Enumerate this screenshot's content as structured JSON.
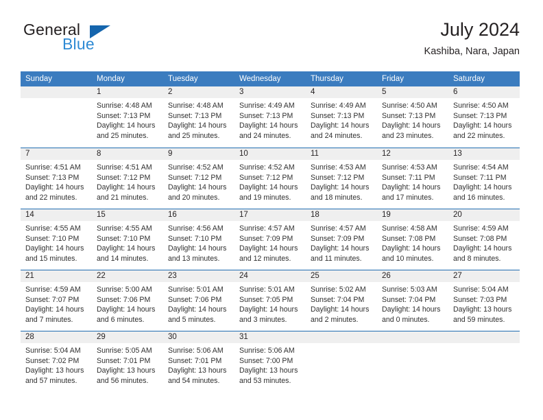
{
  "brand": {
    "name_part1": "General",
    "name_part2": "Blue",
    "triangle_color": "#1565ad",
    "blue_color": "#2e8ad4"
  },
  "header": {
    "title": "July 2024",
    "subtitle": "Kashiba, Nara, Japan",
    "header_bg": "#3b7cbf",
    "row_divider": "#1f6cb0",
    "day_band_bg": "#efefef"
  },
  "weekdays": [
    "Sunday",
    "Monday",
    "Tuesday",
    "Wednesday",
    "Thursday",
    "Friday",
    "Saturday"
  ],
  "weeks": [
    [
      {
        "date": "",
        "empty": true,
        "sunrise": "",
        "sunset": "",
        "daylight1": "",
        "daylight2": ""
      },
      {
        "date": "1",
        "sunrise": "Sunrise: 4:48 AM",
        "sunset": "Sunset: 7:13 PM",
        "daylight1": "Daylight: 14 hours",
        "daylight2": "and 25 minutes."
      },
      {
        "date": "2",
        "sunrise": "Sunrise: 4:48 AM",
        "sunset": "Sunset: 7:13 PM",
        "daylight1": "Daylight: 14 hours",
        "daylight2": "and 25 minutes."
      },
      {
        "date": "3",
        "sunrise": "Sunrise: 4:49 AM",
        "sunset": "Sunset: 7:13 PM",
        "daylight1": "Daylight: 14 hours",
        "daylight2": "and 24 minutes."
      },
      {
        "date": "4",
        "sunrise": "Sunrise: 4:49 AM",
        "sunset": "Sunset: 7:13 PM",
        "daylight1": "Daylight: 14 hours",
        "daylight2": "and 24 minutes."
      },
      {
        "date": "5",
        "sunrise": "Sunrise: 4:50 AM",
        "sunset": "Sunset: 7:13 PM",
        "daylight1": "Daylight: 14 hours",
        "daylight2": "and 23 minutes."
      },
      {
        "date": "6",
        "sunrise": "Sunrise: 4:50 AM",
        "sunset": "Sunset: 7:13 PM",
        "daylight1": "Daylight: 14 hours",
        "daylight2": "and 22 minutes."
      }
    ],
    [
      {
        "date": "7",
        "sunrise": "Sunrise: 4:51 AM",
        "sunset": "Sunset: 7:13 PM",
        "daylight1": "Daylight: 14 hours",
        "daylight2": "and 22 minutes."
      },
      {
        "date": "8",
        "sunrise": "Sunrise: 4:51 AM",
        "sunset": "Sunset: 7:12 PM",
        "daylight1": "Daylight: 14 hours",
        "daylight2": "and 21 minutes."
      },
      {
        "date": "9",
        "sunrise": "Sunrise: 4:52 AM",
        "sunset": "Sunset: 7:12 PM",
        "daylight1": "Daylight: 14 hours",
        "daylight2": "and 20 minutes."
      },
      {
        "date": "10",
        "sunrise": "Sunrise: 4:52 AM",
        "sunset": "Sunset: 7:12 PM",
        "daylight1": "Daylight: 14 hours",
        "daylight2": "and 19 minutes."
      },
      {
        "date": "11",
        "sunrise": "Sunrise: 4:53 AM",
        "sunset": "Sunset: 7:12 PM",
        "daylight1": "Daylight: 14 hours",
        "daylight2": "and 18 minutes."
      },
      {
        "date": "12",
        "sunrise": "Sunrise: 4:53 AM",
        "sunset": "Sunset: 7:11 PM",
        "daylight1": "Daylight: 14 hours",
        "daylight2": "and 17 minutes."
      },
      {
        "date": "13",
        "sunrise": "Sunrise: 4:54 AM",
        "sunset": "Sunset: 7:11 PM",
        "daylight1": "Daylight: 14 hours",
        "daylight2": "and 16 minutes."
      }
    ],
    [
      {
        "date": "14",
        "sunrise": "Sunrise: 4:55 AM",
        "sunset": "Sunset: 7:10 PM",
        "daylight1": "Daylight: 14 hours",
        "daylight2": "and 15 minutes."
      },
      {
        "date": "15",
        "sunrise": "Sunrise: 4:55 AM",
        "sunset": "Sunset: 7:10 PM",
        "daylight1": "Daylight: 14 hours",
        "daylight2": "and 14 minutes."
      },
      {
        "date": "16",
        "sunrise": "Sunrise: 4:56 AM",
        "sunset": "Sunset: 7:10 PM",
        "daylight1": "Daylight: 14 hours",
        "daylight2": "and 13 minutes."
      },
      {
        "date": "17",
        "sunrise": "Sunrise: 4:57 AM",
        "sunset": "Sunset: 7:09 PM",
        "daylight1": "Daylight: 14 hours",
        "daylight2": "and 12 minutes."
      },
      {
        "date": "18",
        "sunrise": "Sunrise: 4:57 AM",
        "sunset": "Sunset: 7:09 PM",
        "daylight1": "Daylight: 14 hours",
        "daylight2": "and 11 minutes."
      },
      {
        "date": "19",
        "sunrise": "Sunrise: 4:58 AM",
        "sunset": "Sunset: 7:08 PM",
        "daylight1": "Daylight: 14 hours",
        "daylight2": "and 10 minutes."
      },
      {
        "date": "20",
        "sunrise": "Sunrise: 4:59 AM",
        "sunset": "Sunset: 7:08 PM",
        "daylight1": "Daylight: 14 hours",
        "daylight2": "and 8 minutes."
      }
    ],
    [
      {
        "date": "21",
        "sunrise": "Sunrise: 4:59 AM",
        "sunset": "Sunset: 7:07 PM",
        "daylight1": "Daylight: 14 hours",
        "daylight2": "and 7 minutes."
      },
      {
        "date": "22",
        "sunrise": "Sunrise: 5:00 AM",
        "sunset": "Sunset: 7:06 PM",
        "daylight1": "Daylight: 14 hours",
        "daylight2": "and 6 minutes."
      },
      {
        "date": "23",
        "sunrise": "Sunrise: 5:01 AM",
        "sunset": "Sunset: 7:06 PM",
        "daylight1": "Daylight: 14 hours",
        "daylight2": "and 5 minutes."
      },
      {
        "date": "24",
        "sunrise": "Sunrise: 5:01 AM",
        "sunset": "Sunset: 7:05 PM",
        "daylight1": "Daylight: 14 hours",
        "daylight2": "and 3 minutes."
      },
      {
        "date": "25",
        "sunrise": "Sunrise: 5:02 AM",
        "sunset": "Sunset: 7:04 PM",
        "daylight1": "Daylight: 14 hours",
        "daylight2": "and 2 minutes."
      },
      {
        "date": "26",
        "sunrise": "Sunrise: 5:03 AM",
        "sunset": "Sunset: 7:04 PM",
        "daylight1": "Daylight: 14 hours",
        "daylight2": "and 0 minutes."
      },
      {
        "date": "27",
        "sunrise": "Sunrise: 5:04 AM",
        "sunset": "Sunset: 7:03 PM",
        "daylight1": "Daylight: 13 hours",
        "daylight2": "and 59 minutes."
      }
    ],
    [
      {
        "date": "28",
        "sunrise": "Sunrise: 5:04 AM",
        "sunset": "Sunset: 7:02 PM",
        "daylight1": "Daylight: 13 hours",
        "daylight2": "and 57 minutes."
      },
      {
        "date": "29",
        "sunrise": "Sunrise: 5:05 AM",
        "sunset": "Sunset: 7:01 PM",
        "daylight1": "Daylight: 13 hours",
        "daylight2": "and 56 minutes."
      },
      {
        "date": "30",
        "sunrise": "Sunrise: 5:06 AM",
        "sunset": "Sunset: 7:01 PM",
        "daylight1": "Daylight: 13 hours",
        "daylight2": "and 54 minutes."
      },
      {
        "date": "31",
        "sunrise": "Sunrise: 5:06 AM",
        "sunset": "Sunset: 7:00 PM",
        "daylight1": "Daylight: 13 hours",
        "daylight2": "and 53 minutes."
      },
      {
        "date": "",
        "empty": true,
        "sunrise": "",
        "sunset": "",
        "daylight1": "",
        "daylight2": ""
      },
      {
        "date": "",
        "empty": true,
        "sunrise": "",
        "sunset": "",
        "daylight1": "",
        "daylight2": ""
      },
      {
        "date": "",
        "empty": true,
        "sunrise": "",
        "sunset": "",
        "daylight1": "",
        "daylight2": ""
      }
    ]
  ]
}
